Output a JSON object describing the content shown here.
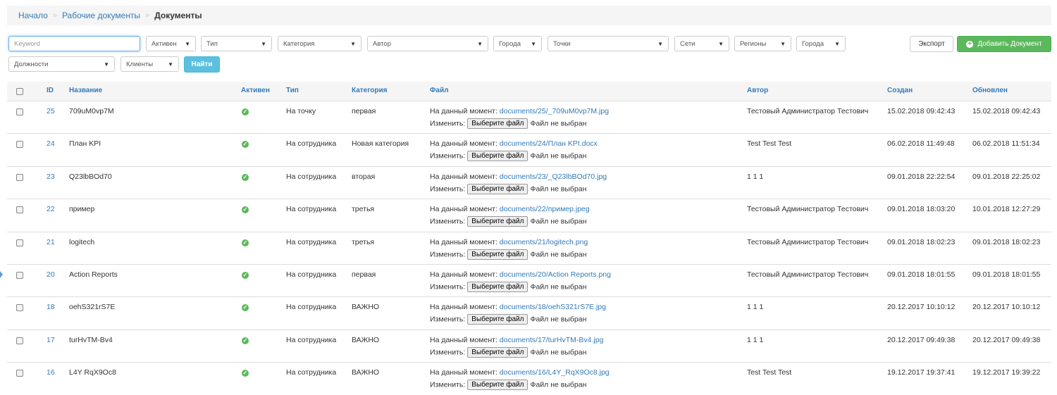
{
  "breadcrumb": {
    "home": "Начало",
    "docs": "Рабочие документы",
    "current": "Документы",
    "separator": "»"
  },
  "filters": {
    "keyword_placeholder": "Keyword",
    "active": "Активен",
    "type": "Тип",
    "category": "Категория",
    "author": "Автор",
    "cities": "Города",
    "points": "Точки",
    "networks": "Сети",
    "regions": "Регионы",
    "cities2": "Города",
    "positions": "Должности",
    "clients": "Клиенты",
    "search_button": "Найти"
  },
  "actions": {
    "export": "Экспорт",
    "add": "Добавить Документ"
  },
  "table": {
    "columns": {
      "id": "ID",
      "name": "Название",
      "active": "Активен",
      "type": "Тип",
      "category": "Категория",
      "file": "Файл",
      "author": "Автор",
      "created": "Создан",
      "updated": "Обновлен"
    },
    "file_current_label": "На данный момент:",
    "file_change_label": "Изменить:",
    "file_choose_button": "Выберите файл",
    "file_none": "Файл не выбран",
    "rows": [
      {
        "id": "25",
        "name": "709uM0vp7M",
        "type": "На точку",
        "category": "первая",
        "file": "documents/25/_709uM0vp7M.jpg",
        "author": "Тестовый Администратор Тестович",
        "created": "15.02.2018 09:42:43",
        "updated": "15.02.2018 09:42:43"
      },
      {
        "id": "24",
        "name": "План KPI",
        "type": "На сотрудника",
        "category": "Новая категория",
        "file": "documents/24/План KPI.docx",
        "author": "Test Test Test",
        "created": "06.02.2018 11:49:48",
        "updated": "06.02.2018 11:51:34"
      },
      {
        "id": "23",
        "name": "Q23lbBOd70",
        "type": "На сотрудника",
        "category": "вторая",
        "file": "documents/23/_Q23lbBOd70.jpg",
        "author": "1 1 1",
        "created": "09.01.2018 22:22:54",
        "updated": "09.01.2018 22:25:02"
      },
      {
        "id": "22",
        "name": "пример",
        "type": "На сотрудника",
        "category": "третья",
        "file": "documents/22/пример.jpeg",
        "author": "Тестовый Администратор Тестович",
        "created": "09.01.2018 18:03:20",
        "updated": "10.01.2018 12:27:29"
      },
      {
        "id": "21",
        "name": "logitech",
        "type": "На сотрудника",
        "category": "третья",
        "file": "documents/21/logitech.png",
        "author": "Тестовый Администратор Тестович",
        "created": "09.01.2018 18:02:23",
        "updated": "09.01.2018 18:02:23"
      },
      {
        "id": "20",
        "name": "Action Reports",
        "type": "На сотрудника",
        "category": "первая",
        "file": "documents/20/Action Reports.png",
        "author": "Тестовый Администратор Тестович",
        "created": "09.01.2018 18:01:55",
        "updated": "09.01.2018 18:01:55"
      },
      {
        "id": "18",
        "name": "oehS321rS7E",
        "type": "На сотрудника",
        "category": "ВАЖНО",
        "file": "documents/18/oehS321rS7E.jpg",
        "author": "1 1 1",
        "created": "20.12.2017 10:10:12",
        "updated": "20.12.2017 10:10:12"
      },
      {
        "id": "17",
        "name": "turHvTM-Bv4",
        "type": "На сотрудника",
        "category": "ВАЖНО",
        "file": "documents/17/turHvTM-Bv4.jpg",
        "author": "1 1 1",
        "created": "20.12.2017 09:49:38",
        "updated": "20.12.2017 09:49:38"
      },
      {
        "id": "16",
        "name": "L4Y RqX9Oc8",
        "type": "На сотрудника",
        "category": "ВАЖНО",
        "file": "documents/16/L4Y_RqX9Oc8.jpg",
        "author": "Test Test Test",
        "created": "19.12.2017 19:37:41",
        "updated": "19.12.2017 19:39:22"
      }
    ]
  }
}
